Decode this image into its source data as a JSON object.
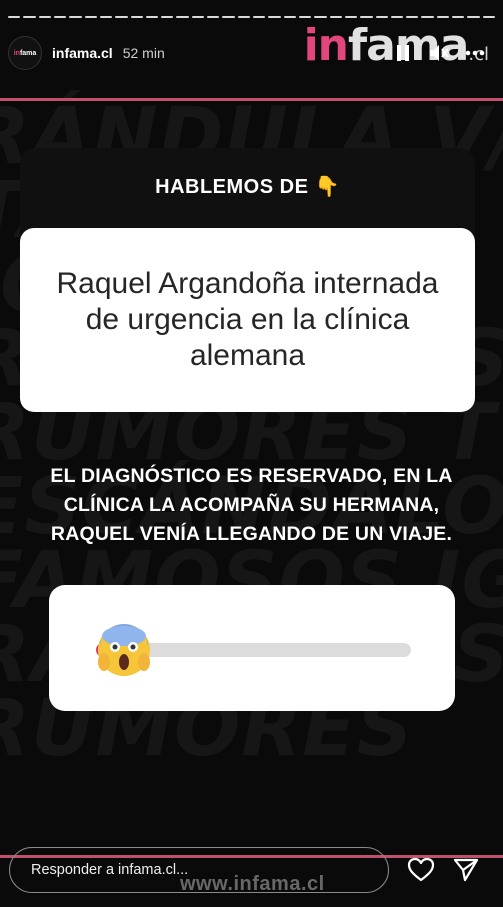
{
  "story": {
    "segments": 32,
    "account": {
      "username": "infama.cl",
      "time_ago": "52 min",
      "avatar_text": {
        "a": "in",
        "b": "fama"
      }
    },
    "brand_logo": {
      "in": "in",
      "fama": "fama",
      "suffix": ".cl"
    },
    "question_card": {
      "header": "HABLEMOS DE 👇",
      "body": "Raquel Argandoña internada de urgencia en la clínica alemana"
    },
    "caption": "EL DIAGNÓSTICO ES RESERVADO, EN LA CLÍNICA LA ACOMPAÑA SU HERMANA, RAQUEL VENÍA LLEGANDO DE UN VIAJE.",
    "emoji_slider": {
      "emoji": "😱",
      "value": 0.09
    },
    "background_words": [
      "RÁNDULA V/R",
      "TA EXCL",
      "IOS",
      "RAL EXCLUSIV",
      "RUMORES TV",
      "ESCÁNDALO",
      "FAMOSOS IG",
      "RAL EXCLUSIV",
      "RUMORES"
    ],
    "reply": {
      "placeholder": "Responder a infama.cl..."
    },
    "watermark": "www.infama.cl",
    "colors": {
      "accent": "#e03b6a",
      "divider": "#c0506c",
      "card_bg": "#ffffff",
      "background": "#0a0a0a"
    },
    "icons": [
      "pause-icon",
      "mute-icon",
      "more-icon",
      "heart-icon",
      "send-icon"
    ]
  }
}
